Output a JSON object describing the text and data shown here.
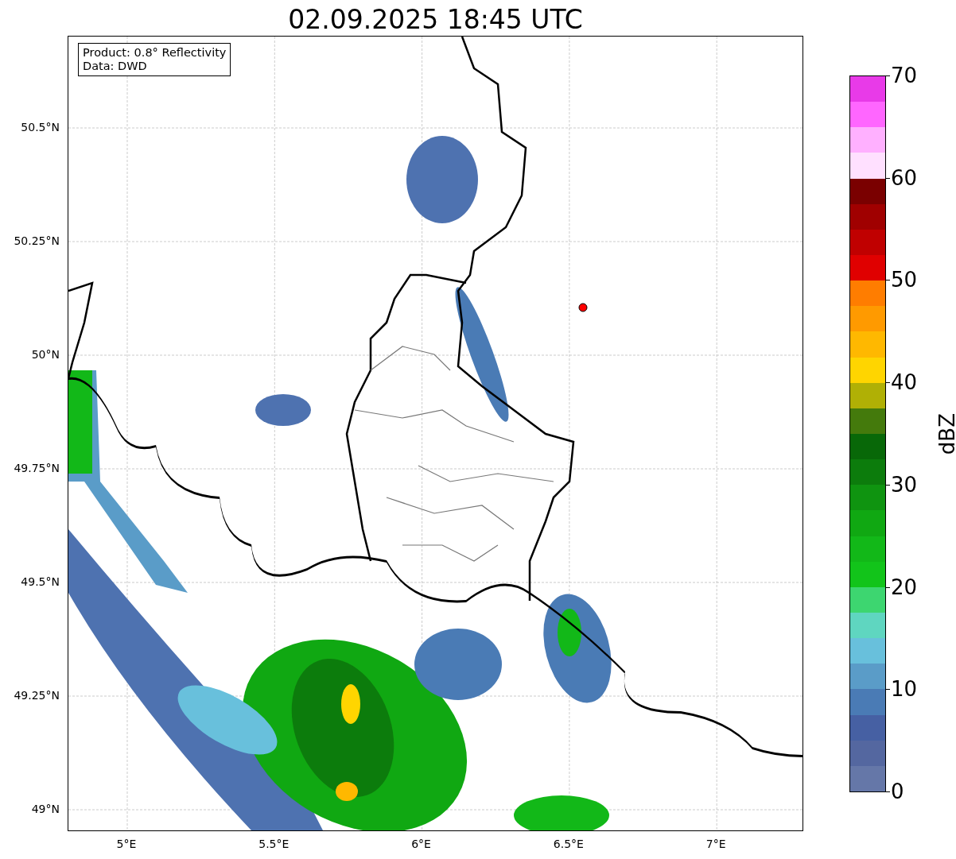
{
  "title": "02.09.2025 18:45 UTC",
  "info_box": {
    "lines": [
      "Product: 0.8° Reflectivity",
      "Data: DWD"
    ]
  },
  "map": {
    "y_ticks": [
      "50.5°N",
      "50.25°N",
      "50°N",
      "49.75°N",
      "49.5°N",
      "49.25°N",
      "49°N"
    ],
    "x_ticks": [
      "5°E",
      "5.5°E",
      "6°E",
      "6.5°E",
      "7°E"
    ]
  },
  "colorbar": {
    "label": "dBZ",
    "ticks": [
      "70",
      "60",
      "50",
      "40",
      "30",
      "20",
      "10",
      "0"
    ],
    "segments": [
      {
        "color": "#e83ae8"
      },
      {
        "color": "#ff66ff"
      },
      {
        "color": "#ffb0ff"
      },
      {
        "color": "#ffe0ff"
      },
      {
        "color": "#7a0000"
      },
      {
        "color": "#a00000"
      },
      {
        "color": "#c00000"
      },
      {
        "color": "#e00000"
      },
      {
        "color": "#ff7d00"
      },
      {
        "color": "#ff9a00"
      },
      {
        "color": "#ffb800"
      },
      {
        "color": "#ffd500"
      },
      {
        "color": "#b0b005"
      },
      {
        "color": "#447a0c"
      },
      {
        "color": "#086808"
      },
      {
        "color": "#0c7c0c"
      },
      {
        "color": "#0f9410"
      },
      {
        "color": "#10a812"
      },
      {
        "color": "#12b818"
      },
      {
        "color": "#12c41a"
      },
      {
        "color": "#3dd670"
      },
      {
        "color": "#5fd6c0"
      },
      {
        "color": "#68c0dc"
      },
      {
        "color": "#5a9cc8"
      },
      {
        "color": "#4a7bb5"
      },
      {
        "color": "#4660a3"
      },
      {
        "color": "#5467a0"
      },
      {
        "color": "#6577a8"
      }
    ]
  }
}
